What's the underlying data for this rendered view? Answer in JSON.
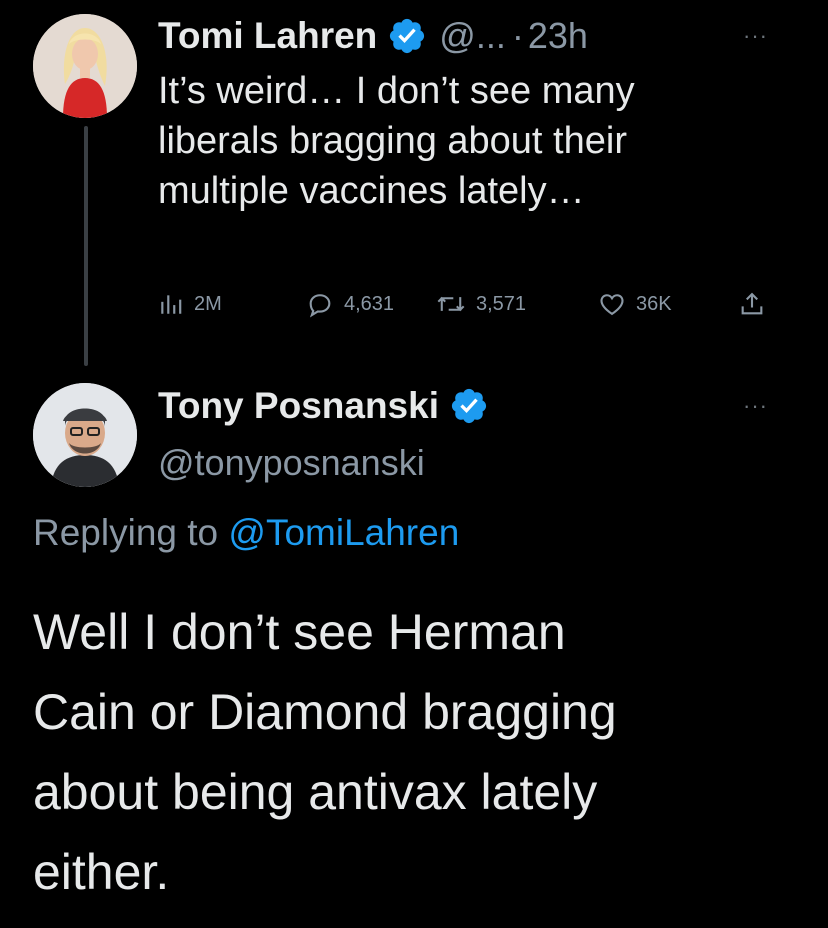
{
  "parent_tweet": {
    "author_name": "Tomi Lahren",
    "handle": "@...",
    "separator": "·",
    "time": "23h",
    "more_label": "···",
    "text": "It’s weird… I don’t see many\nliberals bragging about their\nmultiple vaccines lately…",
    "stats": {
      "views": "2M",
      "replies": "4,631",
      "retweets": "3,571",
      "likes": "36K"
    },
    "avatar_icon": "profile-photo-woman"
  },
  "reply_tweet": {
    "author_name": "Tony Posnanski",
    "handle": "@tonyposnanski",
    "more_label": "···",
    "replying_prefix": "Replying to",
    "replying_mention": "@TomiLahren",
    "text": "Well I don’t see Herman\nCain or Diamond bragging\nabout being antivax lately\neither.",
    "avatar_icon": "profile-photo-man"
  },
  "colors": {
    "background": "#000000",
    "text_primary": "#e7e9ea",
    "text_secondary": "#8b98a5",
    "accent": "#1d9bf0",
    "verified": "#1d9bf0"
  }
}
